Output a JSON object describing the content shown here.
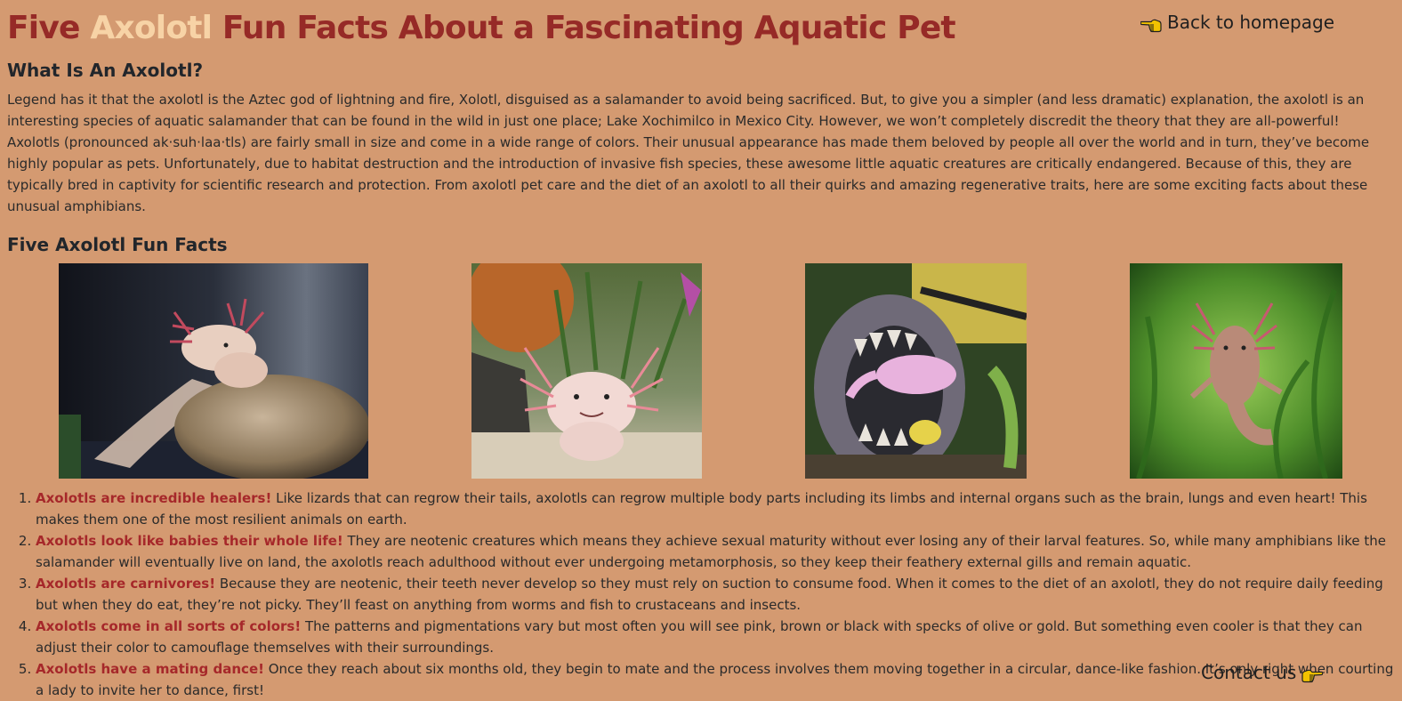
{
  "header": {
    "title_part1": "Five ",
    "title_accent": "Axolotl",
    "title_part2": " Fun Facts About a Fascinating Aquatic Pet",
    "back_link": "Back to homepage"
  },
  "intro": {
    "heading": "What Is An Axolotl?",
    "paragraph": "Legend has it that the axolotl is the Aztec god of lightning and fire, Xolotl, disguised as a salamander to avoid being sacrificed. But, to give you a simpler (and less dramatic) explanation, the axolotl is an interesting species of aquatic salamander that can be found in the wild in just one place; Lake Xochimilco in Mexico City. However, we won’t completely discredit the theory that they are all-powerful! Axolotls (pronounced ak·suh·laa·tls) are fairly small in size and come in a wide range of colors. Their unusual appearance has made them beloved by people all over the world and in turn, they’ve become highly popular as pets. Unfortunately, due to habitat destruction and the introduction of invasive fish species, these awesome little aquatic creatures are critically endangered. Because of this, they are typically bred in captivity for scientific research and protection. From axolotl pet care and the diet of an axolotl to all their quirks and amazing regenerative traits, here are some exciting facts about these unusual amphibians."
  },
  "facts_section": {
    "heading": "Five Axolotl Fun Facts",
    "photos": [
      {
        "icon": "axolotl-on-rock-photo"
      },
      {
        "icon": "pink-axolotl-smiling-photo"
      },
      {
        "icon": "axolotl-in-shark-jaw-photo"
      },
      {
        "icon": "axolotl-swimming-green-photo"
      }
    ],
    "items": [
      {
        "title": "Axolotls are incredible healers!",
        "text": " Like lizards that can regrow their tails, axolotls can regrow multiple body parts including its limbs and internal organs such as the brain, lungs and even heart! This makes them one of the most resilient animals on earth."
      },
      {
        "title": "Axolotls look like babies their whole life!",
        "text": " They are neotenic creatures which means they achieve sexual maturity without ever losing any of their larval features. So, while many amphibians like the salamander will eventually live on land, the axolotls reach adulthood without ever undergoing metamorphosis, so they keep their feathery external gills and remain aquatic."
      },
      {
        "title": "Axolotls are carnivores!",
        "text": " Because they are neotenic, their teeth never develop so they must rely on suction to consume food. When it comes to the diet of an axolotl, they do not require daily feeding but when they do eat, they’re not picky. They’ll feast on anything from worms and fish to crustaceans and insects."
      },
      {
        "title": "Axolotls come in all sorts of colors!",
        "text": " The patterns and pigmentations vary but most often you will see pink, brown or black with specks of olive or gold. But something even cooler is that they can adjust their color to camouflage themselves with their surroundings."
      },
      {
        "title": "Axolotls have a mating dance!",
        "text": " Once they reach about six months old, they begin to mate and the process involves them moving together in a circular, dance-like fashion. It’s only right when courting a lady to invite her to dance, first!"
      }
    ]
  },
  "footer": {
    "contact_link": "Contact us"
  },
  "colors": {
    "background": "#d49a71",
    "title": "#962a27",
    "title_accent": "#f7d3a6",
    "fact_title": "#a6282a",
    "hand_icon": "#f2c200"
  }
}
